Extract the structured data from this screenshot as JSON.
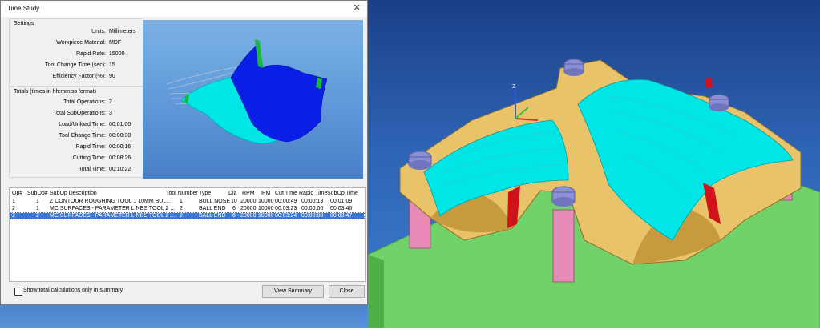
{
  "dialog": {
    "title": "Time Study",
    "settings": {
      "title": "Settings",
      "rows": [
        {
          "label": "Units:",
          "value": "Millimeters"
        },
        {
          "label": "Workpiece Material:",
          "value": "MDF"
        },
        {
          "label": "Rapid Rate:",
          "value": "15000"
        },
        {
          "label": "Tool Change Time (sec):",
          "value": "15"
        },
        {
          "label": "Efficiency Factor (%):",
          "value": "90"
        }
      ]
    },
    "totals": {
      "title": "Totals (times in hh:mm:ss format)",
      "rows": [
        {
          "label": "Total Operations:",
          "value": "2"
        },
        {
          "label": "Total SubOperations:",
          "value": "3"
        },
        {
          "label": "Load/Unload Time:",
          "value": "00:01:00"
        },
        {
          "label": "Tool Change Time:",
          "value": "00:00:30"
        },
        {
          "label": "Rapid Time:",
          "value": "00:00:16"
        },
        {
          "label": "Cutting Time:",
          "value": "00:08:26"
        },
        {
          "label": "Total Time:",
          "value": "00:10:22"
        }
      ]
    },
    "table": {
      "headers": [
        "Op#",
        "SubOp#",
        "SubOp Description",
        "Tool Number",
        "Type",
        "Dia",
        "RPM",
        "IPM",
        "Cut Time",
        "Rapid Time",
        "SubOp Time"
      ],
      "rows": [
        [
          "1",
          "1",
          "Z CONTOUR ROUGHING  TOOL 1   10MM BUL...",
          "1",
          "BULL NOSE",
          "10",
          "20000",
          "10000",
          "00:00:49",
          "00:00:13",
          "00:01:09"
        ],
        [
          "2",
          "1",
          "MC SURFACES - PARAMETER LINES  TOOL 2 ...",
          "2",
          "BALL END",
          "6",
          "20000",
          "10000",
          "00:03:23",
          "00:00:00",
          "00:03:46"
        ],
        [
          "2",
          "2",
          "MC SURFACES - PARAMETER LINES  TOOL 2 ...",
          "2",
          "BALL END",
          "6",
          "20000",
          "10000",
          "00:03:24",
          "00:00:00",
          "00:03:47"
        ]
      ],
      "selected_row": 2
    },
    "checkbox_label": "Show total calculations only in summary",
    "checkbox_checked": false,
    "view_summary_label": "View Summary",
    "close_label": "Close"
  },
  "colors": {
    "selection": "#3b78d8",
    "part_gold": "#e8c36a",
    "toolpath_cyan": "#00e5e5",
    "surface_blue": "#0a1ee6",
    "table_green": "#6fd36a",
    "posts_pink": "#e88ab8",
    "clamps_purple": "#8b8fd6",
    "accent_red": "#d0131b"
  },
  "axis_labels": {
    "z": "Z"
  },
  "icons": {
    "close": "close-icon",
    "axis": "axis-triad-icon"
  }
}
